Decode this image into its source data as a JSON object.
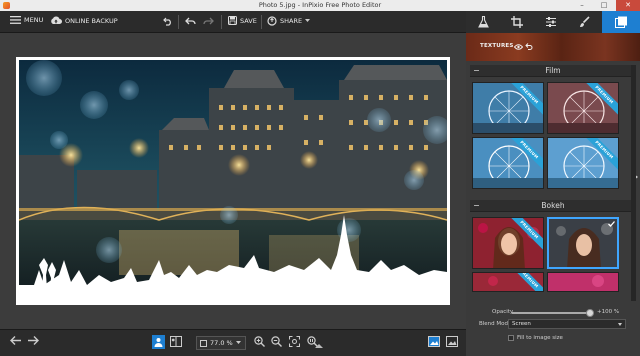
{
  "window": {
    "title": "Photo 5.jpg - InPixio Free Photo Editor",
    "controls": [
      "minimize",
      "maximize",
      "close"
    ]
  },
  "toolbar": {
    "menu_label": "MENU",
    "backup_label": "ONLINE BACKUP",
    "save_label": "SAVE",
    "share_label": "SHARE"
  },
  "tool_tabs": [
    "flask-icon",
    "crop-icon",
    "sliders-icon",
    "frames-icon"
  ],
  "active_tool_tab": "frames-icon",
  "textures": {
    "label": "TEXTURES"
  },
  "sections": [
    {
      "title": "Film",
      "thumbs": [
        "Ferris wheel blue",
        "Ferris wheel red",
        "Ferris wheel blue premium",
        "Ferris wheel cool premium"
      ],
      "ribbons": [
        "PREMIUM",
        "PREMIUM",
        "PREMIUM",
        "PREMIUM"
      ]
    },
    {
      "title": "Bokeh",
      "thumbs": [
        "Portrait bokeh red",
        "Portrait bokeh dark",
        "Portrait bokeh red 2",
        "Portrait bokeh pink"
      ],
      "ribbons": [
        "PREMIUM",
        "",
        "PREMIUM",
        ""
      ]
    }
  ],
  "controls": {
    "opacity_label": "Opacity",
    "opacity_value": "+100 %",
    "opacity_fraction": 0.97,
    "blend_label": "Blend Mode",
    "blend_value": "Screen",
    "fill_label": "Fill to image size",
    "fill_checked": false
  },
  "bottombar": {
    "zoom_value": "77.0 %"
  },
  "colors": {
    "accent": "#1e7fd1",
    "selection": "#3fa6ff",
    "ribbon": "#2aa2d8"
  }
}
